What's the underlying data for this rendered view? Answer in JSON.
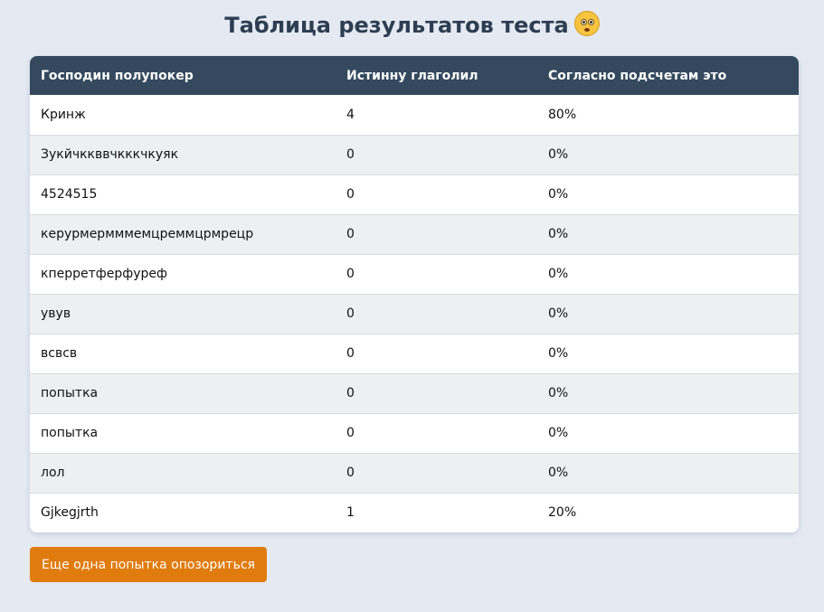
{
  "page": {
    "title": "Таблица результатов теста",
    "title_icon": "flushed-face-icon"
  },
  "table": {
    "headers": [
      "Господин полупокер",
      "Истинну глаголил",
      "Согласно подсчетам это"
    ],
    "rows": [
      [
        "Кринж",
        "4",
        "80%"
      ],
      [
        "Зукйчккввчкккчкуяк",
        "0",
        "0%"
      ],
      [
        "4524515",
        "0",
        "0%"
      ],
      [
        "керурмермммемцреммцрмрецр",
        "0",
        "0%"
      ],
      [
        "кперретферфуреф",
        "0",
        "0%"
      ],
      [
        "увув",
        "0",
        "0%"
      ],
      [
        "всвсв",
        "0",
        "0%"
      ],
      [
        "попытка",
        "0",
        "0%"
      ],
      [
        "попытка",
        "0",
        "0%"
      ],
      [
        "лол",
        "0",
        "0%"
      ],
      [
        "Gjkegjrth",
        "1",
        "20%"
      ]
    ]
  },
  "actions": {
    "retry_label": "Еще одна попытка опозориться"
  },
  "colors": {
    "background": "#e4e9f2",
    "header": "#34495e",
    "row_alt": "#ecf0f1",
    "button": "#e07b0e"
  }
}
